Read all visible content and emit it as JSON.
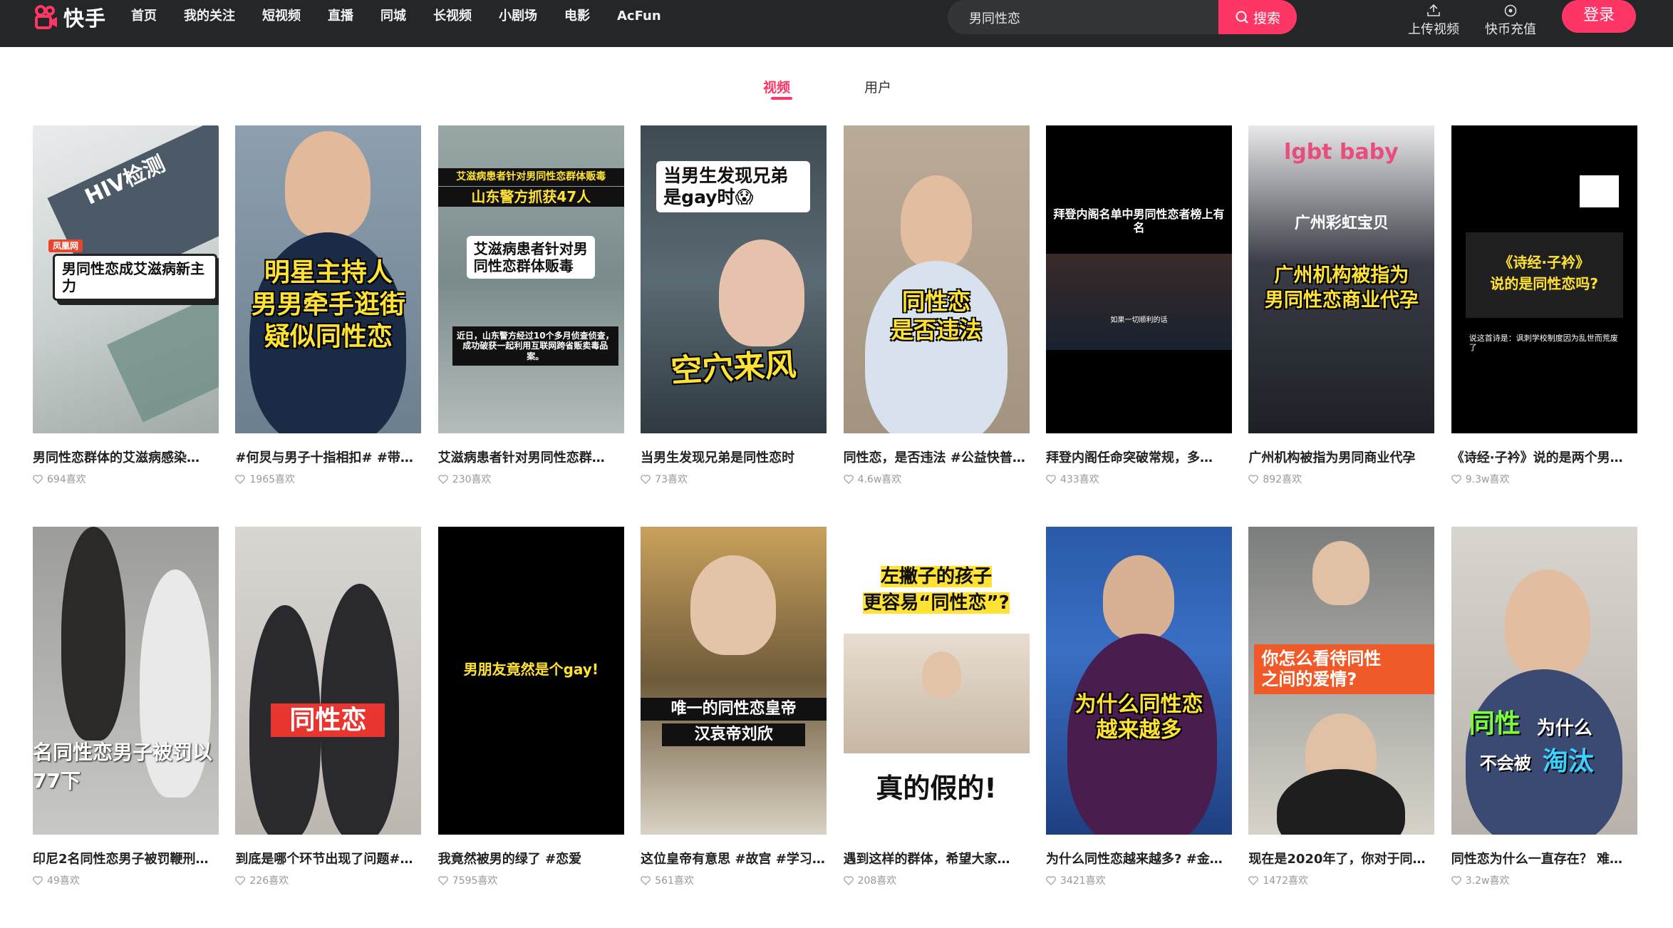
{
  "brand": {
    "name": "快手",
    "color": "#fe3666"
  },
  "nav": [
    "首页",
    "我的关注",
    "短视频",
    "直播",
    "同城",
    "长视频",
    "小剧场",
    "电影",
    "AcFun"
  ],
  "search": {
    "value": "男同性恋",
    "button": "搜索"
  },
  "header": {
    "upload": "上传视频",
    "recharge": "快币充值",
    "login": "登录"
  },
  "tabs": {
    "video": "视频",
    "user": "用户"
  },
  "cards": [
    {
      "title": "男同性恋群体的艾滋病感染…",
      "likes": "694喜欢",
      "overlay": [
        "男同性恋成艾滋病新主力"
      ],
      "badge": "凤凰网",
      "sign": "HIV检测"
    },
    {
      "title": "#何炅与男子十指相扣# #带你…",
      "likes": "1965喜欢",
      "overlay": [
        "明星主持人",
        "男男牵手逛街",
        "疑似同性恋"
      ]
    },
    {
      "title": "艾滋病患者针对男同性恋群…",
      "likes": "230喜欢",
      "overlay": [
        "艾滋病患者针对男同性恋群体贩毒",
        "山东警方抓获47人",
        "艾滋病患者针对男同性恋群体贩毒",
        "近日，山东警方经过10个多月侦查侦查，成功破获一起利用互联网跨省贩卖毒品案。"
      ]
    },
    {
      "title": "当男生发现兄弟是同性恋时",
      "likes": "73喜欢",
      "overlay": [
        "当男生发现兄弟是gay时😱",
        "空穴来风"
      ]
    },
    {
      "title": "同性恋，是否违法 #公益快普…",
      "likes": "4.6w喜欢",
      "overlay": [
        "同性恋",
        "是否违法"
      ]
    },
    {
      "title": "拜登内阁任命突破常规，多…",
      "likes": "433喜欢",
      "overlay": [
        "拜登内阁名单中男同性恋者榜上有名",
        "如果一切顺利的话"
      ]
    },
    {
      "title": "广州机构被指为男同商业代孕",
      "likes": "892喜欢",
      "overlay": [
        "lgbt baby",
        "广州彩虹宝贝",
        "广州机构被指为",
        "男同性恋商业代孕"
      ]
    },
    {
      "title": "《诗经·子衿》说的是两个男…",
      "likes": "9.3w喜欢",
      "overlay": [
        "《诗经·子衿》",
        "说的是同性恋吗?",
        "说这首诗是：讽刺学校制度因为乱世而荒废了"
      ]
    },
    {
      "title": "印尼2名同性恋男子被罚鞭刑…",
      "likes": "49喜欢",
      "overlay": [
        "名同性恋男子被罚以",
        "77下"
      ]
    },
    {
      "title": "到底是哪个环节出现了问题#…",
      "likes": "226喜欢",
      "overlay": [
        "同性恋"
      ]
    },
    {
      "title": "我竟然被男的绿了 #恋爱",
      "likes": "7595喜欢",
      "overlay": [
        "男朋友竟然是个gay!"
      ]
    },
    {
      "title": "这位皇帝有意思 #故宫 #学习…",
      "likes": "561喜欢",
      "overlay": [
        "唯一的同性恋皇帝",
        "汉哀帝刘欣"
      ]
    },
    {
      "title": "遇到这样的群体，希望大家…",
      "likes": "208喜欢",
      "overlay": [
        "左撇子的孩子",
        "更容易“同性恋”?",
        "真的假的!"
      ]
    },
    {
      "title": "为什么同性恋越来越多? #金…",
      "likes": "3421喜欢",
      "overlay": [
        "为什么同性恋",
        "越来越多"
      ]
    },
    {
      "title": "现在是2020年了，你对于同…",
      "likes": "1472喜欢",
      "overlay": [
        "你怎么看待同性",
        "之间的爱情?"
      ]
    },
    {
      "title": "同性恋为什么一直存在？ 难…",
      "likes": "3.2w喜欢",
      "overlay": [
        "同性",
        "为什么",
        "不会被",
        "淘汰"
      ]
    }
  ]
}
